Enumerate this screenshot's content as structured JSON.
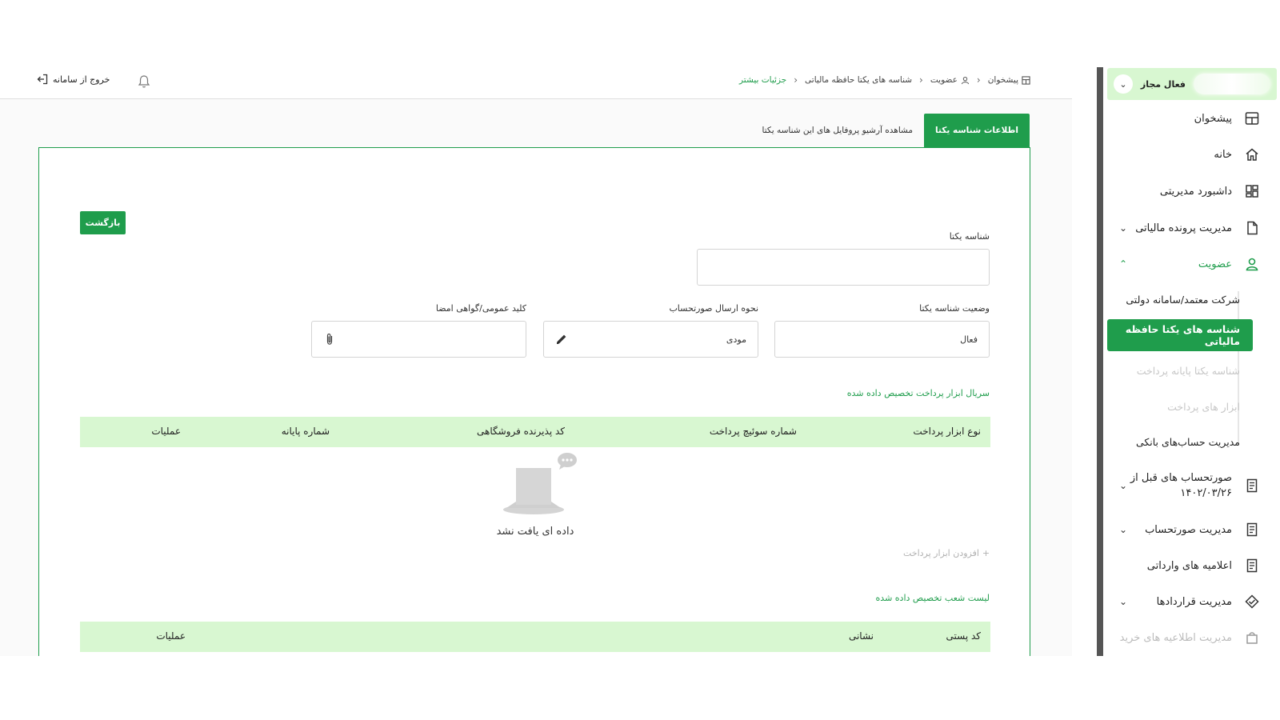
{
  "sidebar": {
    "user": {
      "name": "فعال مجاز"
    },
    "items": [
      {
        "label": "پیشخوان",
        "icon": "dashboard-icon"
      },
      {
        "label": "خانه",
        "icon": "home-icon"
      },
      {
        "label": "داشبورد مدیریتی",
        "icon": "grid-icon"
      },
      {
        "label": "مدیریت پرونده مالیاتی",
        "icon": "file-icon"
      },
      {
        "label": "عضویت",
        "icon": "user-icon"
      }
    ],
    "sub_items": [
      {
        "label": "شرکت معتمد/سامانه دولتی"
      },
      {
        "label": "شناسه های یکتا حافظه مالیاتی"
      },
      {
        "label": "شناسه یکتا پایانه پرداخت"
      },
      {
        "label": "ابزار های پرداخت"
      },
      {
        "label": "مدیریت حساب‌های بانکی"
      }
    ],
    "items_after": [
      {
        "label_line1": "صورتحساب های قبل از",
        "label_line2": "۱۴۰۲/۰۳/۲۶",
        "icon": "invoice-icon"
      },
      {
        "label": "مدیریت صورتحساب",
        "icon": "invoice-icon"
      },
      {
        "label": "اعلامیه های وارداتی",
        "icon": "invoice-icon"
      },
      {
        "label": "مدیریت قراردادها",
        "icon": "contract-icon"
      },
      {
        "label": "مدیریت اطلاعیه های خرید",
        "icon": "bag-icon"
      }
    ]
  },
  "topbar": {
    "breadcrumb": [
      "پیشخوان",
      "عضویت",
      "شناسه های یکتا حافظه مالیاتی",
      "جزئیات بیشتر"
    ],
    "logout_label": "خروج از سامانه"
  },
  "tabs": [
    {
      "label": "اطلاعات شناسه یکتا",
      "active": true
    },
    {
      "label": "مشاهده آرشیو پروفایل های این شناسه یکتا",
      "active": false
    }
  ],
  "form": {
    "back_label": "بازگشت",
    "unique_id": {
      "label": "شناسه یکتا",
      "value": ""
    },
    "status": {
      "label": "وضعیت شناسه یکتا",
      "value": "فعال"
    },
    "send_method": {
      "label": "نحوه ارسال صورتحساب",
      "value": "مودی"
    },
    "public_key": {
      "label": "کلید عمومی/گواهی امضا",
      "value": ""
    }
  },
  "payment_section": {
    "title": "سریال ابزار پرداخت تخصیص داده شده",
    "columns": [
      "نوع ابزار پرداخت",
      "شماره سوئیچ پرداخت",
      "کد پذیرنده فروشگاهی",
      "شماره پایانه",
      "عملیات"
    ],
    "empty_text": "داده ای یافت نشد",
    "add_label": "افزودن ابزار پرداخت"
  },
  "branches_section": {
    "title": "لیست شعب تخصیص داده شده",
    "columns": [
      "کد پستی",
      "نشانی",
      "عملیات"
    ]
  },
  "colors": {
    "accent": "#1f9d4c",
    "header_bg": "#d8f7d1"
  }
}
